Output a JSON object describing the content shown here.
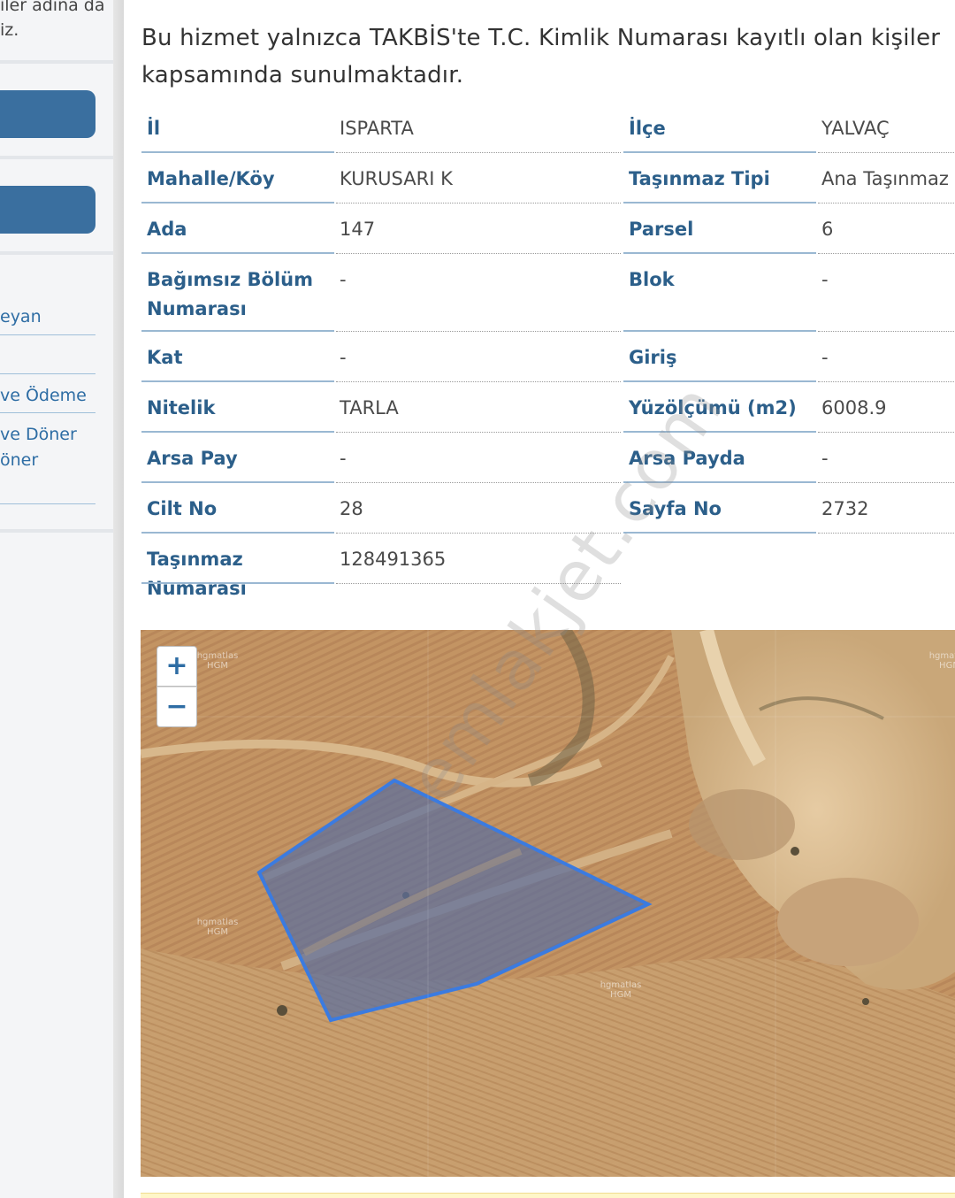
{
  "sidebar": {
    "text_line1": "iler adına da",
    "text_line2": "iz.",
    "links": [
      "eyan",
      "ve Ödeme",
      "ve Döner",
      "öner"
    ]
  },
  "notice": "Bu hizmet yalnızca TAKBİS'te T.C. Kimlik Numarası kayıtlı olan kişiler kapsamında sunulmaktadır.",
  "property": {
    "rows": [
      {
        "l1": "İl",
        "v1": "ISPARTA",
        "l2": "İlçe",
        "v2": "YALVAÇ"
      },
      {
        "l1": "Mahalle/Köy",
        "v1": "KURUSARI K",
        "l2": "Taşınmaz Tipi",
        "v2": "Ana Taşınmaz"
      },
      {
        "l1": "Ada",
        "v1": "147",
        "l2": "Parsel",
        "v2": "6"
      },
      {
        "l1": "Bağımsız Bölüm Numarası",
        "v1": "-",
        "l2": "Blok",
        "v2": "-"
      },
      {
        "l1": "Kat",
        "v1": "-",
        "l2": "Giriş",
        "v2": "-"
      },
      {
        "l1": "Nitelik",
        "v1": "TARLA",
        "l2": "Yüzölçümü (m2)",
        "v2": "6008.9"
      },
      {
        "l1": "Arsa Pay",
        "v1": "-",
        "l2": "Arsa Payda",
        "v2": "-"
      },
      {
        "l1": "Cilt No",
        "v1": "28",
        "l2": "Sayfa No",
        "v2": "2732"
      },
      {
        "l1": "Taşınmaz Numarası",
        "v1": "128491365"
      }
    ]
  },
  "map": {
    "zoom_in": "+",
    "zoom_out": "−",
    "tile_label": "hgmatlas HGM",
    "parcel_color": "#3b7be0"
  },
  "watermark": "emlakjet.com"
}
